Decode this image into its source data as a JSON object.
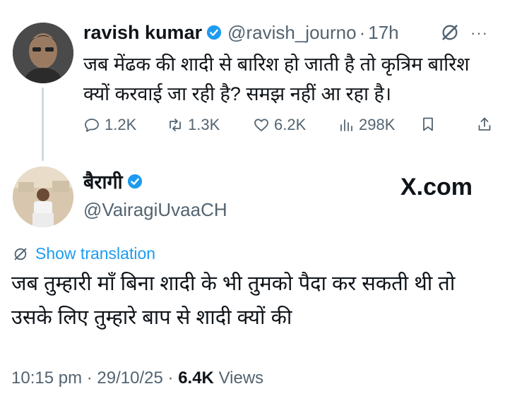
{
  "parent": {
    "display_name": "ravish kumar",
    "handle": "@ravish_journo",
    "separator": "·",
    "time_ago": "17h",
    "text": "जब मेंढक की शादी से बारिश हो जाती है तो कृत्रिम बारिश क्यों करवाई जा रही है? समझ नहीं आ रहा है।",
    "stats": {
      "replies": "1.2K",
      "reposts": "1.3K",
      "likes": "6.2K",
      "views": "298K"
    },
    "more_label": "···"
  },
  "reply": {
    "display_name": "बैरागी",
    "handle": "@VairagiUvaaCH",
    "watermark": "X.com",
    "translate_label": "Show translation",
    "text": "जब तुम्हारी माँ बिना शादी के भी तुमको पैदा कर सकती थी तो उसके लिए तुम्हारे बाप से शादी क्यों की",
    "time": "10:15 pm",
    "date": "29/10/25",
    "sep": "·",
    "views_count": "6.4K",
    "views_label": "Views"
  },
  "colors": {
    "accent": "#1d9bf0",
    "secondary_text": "#536471",
    "primary_text": "#0f1419"
  },
  "icons": [
    "verified-badge-icon",
    "grok-icon",
    "more-icon",
    "reply-icon",
    "repost-icon",
    "like-icon",
    "views-icon",
    "bookmark-icon",
    "share-icon",
    "translate-globe-icon"
  ]
}
